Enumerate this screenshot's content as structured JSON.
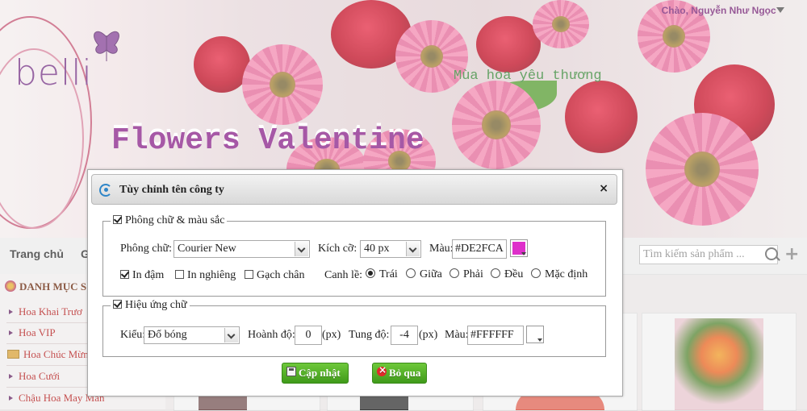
{
  "header": {
    "greeting": "Chào, Nguyễn Như Ngọc",
    "logo_text": "belli",
    "slogan": "Mùa hoa yêu thương",
    "banner_title": "Flowers Valentine"
  },
  "nav": {
    "items": [
      {
        "label": "Trang chủ"
      },
      {
        "label": "G"
      }
    ],
    "search_placeholder": "Tìm kiếm sản phẩm ..."
  },
  "categories": {
    "title": "DANH MỤC S",
    "items": [
      {
        "label": "Hoa Khai Trươ"
      },
      {
        "label": "Hoa VIP"
      },
      {
        "label": "Hoa Chúc Mừn"
      },
      {
        "label": "Hoa Cưới"
      },
      {
        "label": "Chậu Hoa May Mắn"
      }
    ]
  },
  "dialog": {
    "title": "Tùy chỉnh tên công ty",
    "close": "×",
    "font_group": {
      "legend": "Phông chữ & màu sắc",
      "font_label": "Phông chữ:",
      "font_value": "Courier New",
      "size_label": "Kích cỡ:",
      "size_value": "40 px",
      "color_label": "Màu:",
      "color_value": "#DE2FCA",
      "bold_label": "In đậm",
      "italic_label": "In nghiêng",
      "underline_label": "Gạch chân",
      "align_label": "Canh lề:",
      "align_options": [
        {
          "label": "Trái",
          "selected": true
        },
        {
          "label": "Giữa",
          "selected": false
        },
        {
          "label": "Phải",
          "selected": false
        },
        {
          "label": "Đều",
          "selected": false
        },
        {
          "label": "Mặc định",
          "selected": false
        }
      ],
      "bold": true,
      "italic": false,
      "underline": false
    },
    "effect_group": {
      "legend": "Hiệu ứng chữ",
      "enabled": true,
      "type_label": "Kiểu:",
      "type_value": "Đổ bóng",
      "hoffset_label": "Hoành độ:",
      "hoffset_value": "0",
      "voffset_label": "Tung độ:",
      "voffset_value": "-4",
      "unit": "(px)",
      "color_label": "Màu:",
      "color_value": "#FFFFFF"
    },
    "buttons": {
      "save": "Cập nhật",
      "cancel": "Bỏ qua"
    }
  },
  "colors": {
    "accent_purple": "#7a2b7a",
    "button_green": "#4caf1e",
    "swatch_font_color": "#DE2FCA",
    "swatch_shadow_color": "#FFFFFF"
  }
}
